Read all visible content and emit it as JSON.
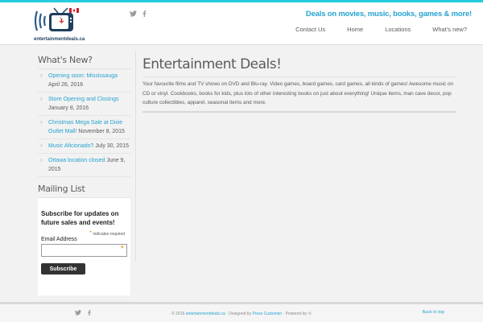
{
  "header": {
    "logo_text": "entertainmentdeals.ca",
    "tagline": "Deals on movies, music, books, games & more!",
    "social": [
      {
        "icon": "twitter-icon",
        "glyph": "🐦"
      },
      {
        "icon": "facebook-icon",
        "glyph": "f"
      }
    ],
    "nav": [
      "Contact Us",
      "Home",
      "Locations",
      "What's new?"
    ]
  },
  "sidebar": {
    "whats_new_title": "What's New?",
    "news": [
      {
        "link": "Opening soon: Mississauga",
        "date": "April 26, 2016"
      },
      {
        "link": "Store Opening and Closings",
        "date": "January 8, 2016"
      },
      {
        "link": "Christmas Mega Sale at Dixie Outlet Mall!",
        "date": "November 8, 2015"
      },
      {
        "link": "Music Aficionado?",
        "date": "July 30, 2015"
      },
      {
        "link": "Ottawa location closed",
        "date": "June 9, 2015"
      }
    ],
    "mailing_title": "Mailing List",
    "mailchimp": {
      "heading": "Subscribe for updates on future sales and events!",
      "required_note": "indicates required",
      "email_label": "Email Address",
      "subscribe_label": "Subscribe",
      "email_value": ""
    }
  },
  "main": {
    "title": "Entertainment Deals!",
    "body": "Your favourite films and TV shows on DVD and Blu-ray. Video games, board games, card games, all kinds of games! Awesome music on CD or vinyl. Cookbooks, books for kids, plus lots of other interesting books on just about everything! Unique items, man cave decor, pop culture collectibles, apparel, seasonal items and more."
  },
  "footer": {
    "credits_prefix": "· © 2016 ",
    "site_link": "entertainmentdeals.ca",
    "designed_by": " · Designed by ",
    "designer_link": "Press Customizr",
    "powered_by": " · Powered by ",
    "powered_icon": "wordpress-icon",
    "back_to_top": "Back to top"
  },
  "colors": {
    "accent": "#27a3cf",
    "top_bar": "#27cbe0",
    "button": "#333333"
  }
}
